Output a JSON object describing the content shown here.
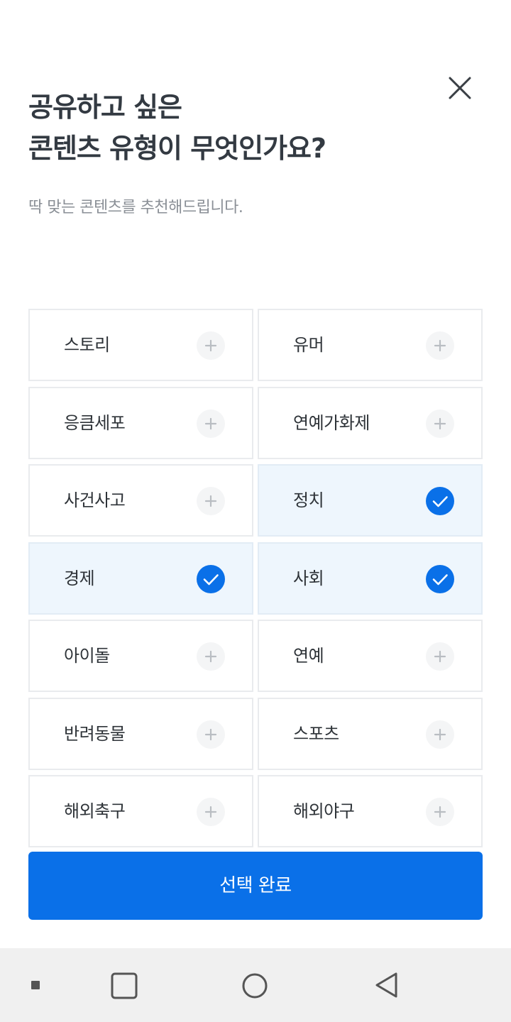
{
  "header": {
    "title_line1": "공유하고 싶은",
    "title_line2": "콘텐츠 유형이 무엇인가요?",
    "subtitle": "딱 맞는 콘텐츠를 추천해드립니다."
  },
  "categories": [
    {
      "label": "스토리",
      "selected": false
    },
    {
      "label": "유머",
      "selected": false
    },
    {
      "label": "응큼세포",
      "selected": false
    },
    {
      "label": "연예가화제",
      "selected": false
    },
    {
      "label": "사건사고",
      "selected": false
    },
    {
      "label": "정치",
      "selected": true
    },
    {
      "label": "경제",
      "selected": true
    },
    {
      "label": "사회",
      "selected": true
    },
    {
      "label": "아이돌",
      "selected": false
    },
    {
      "label": "연예",
      "selected": false
    },
    {
      "label": "반려동물",
      "selected": false
    },
    {
      "label": "스포츠",
      "selected": false
    },
    {
      "label": "해외축구",
      "selected": false
    },
    {
      "label": "해외야구",
      "selected": false
    }
  ],
  "footer": {
    "complete_label": "선택 완료"
  },
  "icons": {
    "close": "close-icon",
    "unselected": "plus-icon",
    "selected": "check-icon"
  },
  "colors": {
    "accent": "#0a70e8",
    "selected_bg": "#eef6fd",
    "title": "#333a42",
    "subtitle": "#8a8f96"
  }
}
